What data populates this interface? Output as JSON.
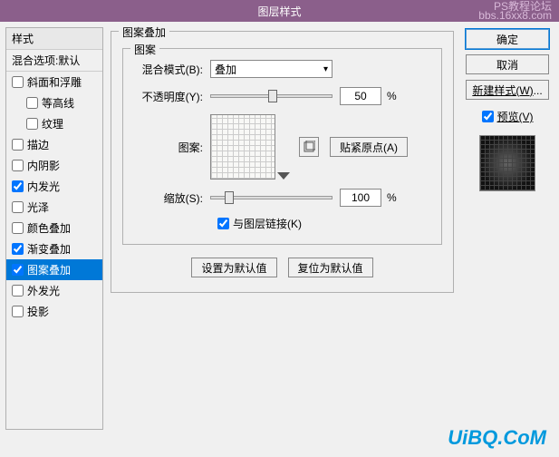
{
  "title": "图层样式",
  "watermark_top_1": "PS教程论坛",
  "watermark_top_2": "bbs.16xx8.com",
  "left": {
    "header": "样式",
    "blend": "混合选项:默认",
    "items": [
      {
        "label": "斜面和浮雕",
        "checked": false
      },
      {
        "label": "等高线",
        "checked": false,
        "indent": true
      },
      {
        "label": "纹理",
        "checked": false,
        "indent": true
      },
      {
        "label": "描边",
        "checked": false
      },
      {
        "label": "内阴影",
        "checked": false
      },
      {
        "label": "内发光",
        "checked": true
      },
      {
        "label": "光泽",
        "checked": false
      },
      {
        "label": "颜色叠加",
        "checked": false
      },
      {
        "label": "渐变叠加",
        "checked": true
      },
      {
        "label": "图案叠加",
        "checked": true,
        "selected": true
      },
      {
        "label": "外发光",
        "checked": false
      },
      {
        "label": "投影",
        "checked": false
      }
    ]
  },
  "middle": {
    "outer_title": "图案叠加",
    "inner_title": "图案",
    "blend_label": "混合模式(B):",
    "blend_value": "叠加",
    "opacity_label": "不透明度(Y):",
    "opacity_value": "50",
    "percent": "%",
    "pattern_label": "图案:",
    "snap_btn": "贴紧原点(A)",
    "scale_label": "缩放(S):",
    "scale_value": "100",
    "link_label": "与图层链接(K)",
    "link_checked": true,
    "default_btn": "设置为默认值",
    "reset_btn": "复位为默认值",
    "create_icon_name": "create-pattern-icon"
  },
  "right": {
    "ok": "确定",
    "cancel": "取消",
    "new_style": "新建样式(W)...",
    "preview_label": "预览(V)",
    "preview_checked": true
  },
  "watermark_bottom": "UiBQ.CoM"
}
